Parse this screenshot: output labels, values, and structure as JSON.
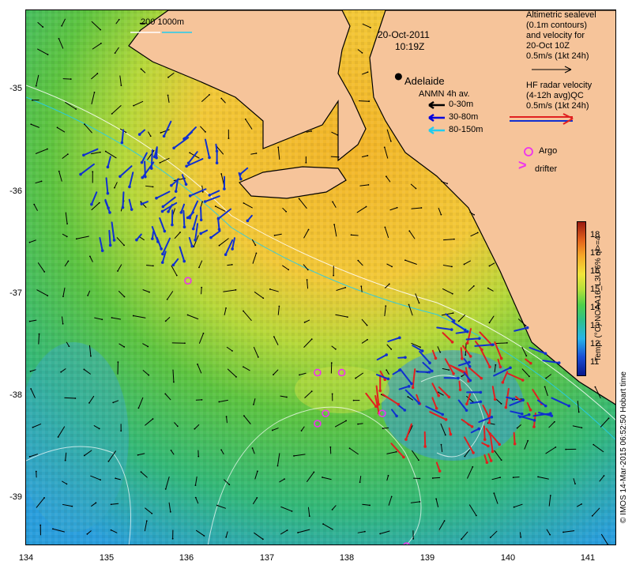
{
  "date": "20-Oct-2011",
  "time": "10:19Z",
  "place_label": "Adelaide",
  "depth_contours_label": "200  1000m",
  "altimetry_legend": {
    "line1": "Altimetric sealevel",
    "line2": "(0.1m contours)",
    "line3": "and velocity for",
    "line4": "20-Oct 10Z",
    "scale": "0.5m/s (1kt 24h)"
  },
  "hf_radar_legend": {
    "line1": "HF radar velocity",
    "line2": "(4-12h avg)",
    "line2_suffix": "QC",
    "scale": "0.5m/s (1kt 24h)"
  },
  "anmn_legend": {
    "title": "ANMN 4h av.",
    "items": [
      {
        "label": "0-30m",
        "color": "#000000"
      },
      {
        "label": "30-80m",
        "color": "#0000dd"
      },
      {
        "label": "80-150m",
        "color": "#22ccee"
      }
    ]
  },
  "argo_legend": {
    "label": "Argo",
    "color": "#ee33ee"
  },
  "drifter_legend": {
    "symbol": ">",
    "label": "drifter",
    "color": "#ee33ee"
  },
  "colorbar": {
    "label": "Temp. (°C) NOAA16_L3U 6% ql>=4",
    "ticks": [
      "18",
      "17",
      "16",
      "15",
      "14",
      "13",
      "12",
      "11"
    ]
  },
  "credit": "© IMOS 14-Mar-2015 06:52:50 Hobart time",
  "axes": {
    "x_ticks": [
      "134",
      "135",
      "136",
      "137",
      "138",
      "139",
      "140",
      "141"
    ],
    "y_ticks": [
      "-35",
      "-36",
      "-37",
      "-38",
      "-39"
    ],
    "xlim": [
      134.0,
      141.3
    ],
    "ylim": [
      -39.5,
      -34.25
    ]
  },
  "colors": {
    "land": "#f6c49a",
    "sea_warm": "#f0c030",
    "sea_mid": "#6ec640",
    "sea_cool": "#2fbe96",
    "hf_radar_red": "#e02020",
    "hf_radar_blue": "#1030d0"
  },
  "argo_floats": [
    {
      "lon": 136.0,
      "lat": -36.9
    },
    {
      "lon": 137.6,
      "lat": -37.8
    },
    {
      "lon": 137.9,
      "lat": -37.8
    },
    {
      "lon": 137.7,
      "lat": -38.2
    },
    {
      "lon": 137.6,
      "lat": -38.3
    },
    {
      "lon": 138.4,
      "lat": -38.2
    },
    {
      "lon": 138.7,
      "lat": -39.5
    }
  ],
  "adelaide_position": {
    "lon": 138.6,
    "lat": -34.9
  }
}
